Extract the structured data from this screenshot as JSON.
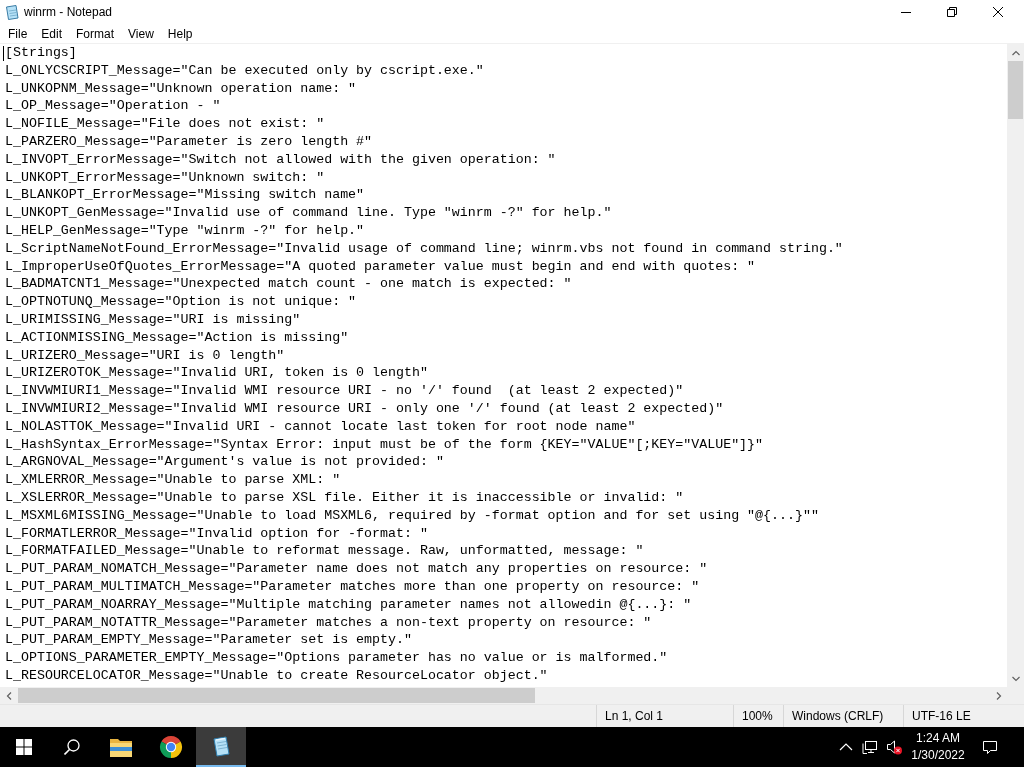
{
  "window": {
    "title": "winrm - Notepad"
  },
  "menu": [
    "File",
    "Edit",
    "Format",
    "View",
    "Help"
  ],
  "editor": {
    "lines": [
      "[Strings]",
      "L_ONLYCSCRIPT_Message=\"Can be executed only by cscript.exe.\"",
      "L_UNKOPNM_Message=\"Unknown operation name: \"",
      "L_OP_Message=\"Operation - \"",
      "L_NOFILE_Message=\"File does not exist: \"",
      "L_PARZERO_Message=\"Parameter is zero length #\"",
      "L_INVOPT_ErrorMessage=\"Switch not allowed with the given operation: \"",
      "L_UNKOPT_ErrorMessage=\"Unknown switch: \"",
      "L_BLANKOPT_ErrorMessage=\"Missing switch name\"",
      "L_UNKOPT_GenMessage=\"Invalid use of command line. Type \"winrm -?\" for help.\"",
      "L_HELP_GenMessage=\"Type \"winrm -?\" for help.\"",
      "L_ScriptNameNotFound_ErrorMessage=\"Invalid usage of command line; winrm.vbs not found in command string.\"",
      "L_ImproperUseOfQuotes_ErrorMessage=\"A quoted parameter value must begin and end with quotes: \"",
      "L_BADMATCNT1_Message=\"Unexpected match count - one match is expected: \"",
      "L_OPTNOTUNQ_Message=\"Option is not unique: \"",
      "L_URIMISSING_Message=\"URI is missing\"",
      "L_ACTIONMISSING_Message=\"Action is missing\"",
      "L_URIZERO_Message=\"URI is 0 length\"",
      "L_URIZEROTOK_Message=\"Invalid URI, token is 0 length\"",
      "L_INVWMIURI1_Message=\"Invalid WMI resource URI - no '/' found  (at least 2 expected)\"",
      "L_INVWMIURI2_Message=\"Invalid WMI resource URI - only one '/' found (at least 2 expected)\"",
      "L_NOLASTTOK_Message=\"Invalid URI - cannot locate last token for root node name\"",
      "L_HashSyntax_ErrorMessage=\"Syntax Error: input must be of the form {KEY=\"VALUE\"[;KEY=\"VALUE\"]}\"",
      "L_ARGNOVAL_Message=\"Argument's value is not provided: \"",
      "L_XMLERROR_Message=\"Unable to parse XML: \"",
      "L_XSLERROR_Message=\"Unable to parse XSL file. Either it is inaccessible or invalid: \"",
      "L_MSXML6MISSING_Message=\"Unable to load MSXML6, required by -format option and for set using \"@{...}\"\"",
      "L_FORMATLERROR_Message=\"Invalid option for -format: \"",
      "L_FORMATFAILED_Message=\"Unable to reformat message. Raw, unformatted, message: \"",
      "L_PUT_PARAM_NOMATCH_Message=\"Parameter name does not match any properties on resource: \"",
      "L_PUT_PARAM_MULTIMATCH_Message=\"Parameter matches more than one property on resource: \"",
      "L_PUT_PARAM_NOARRAY_Message=\"Multiple matching parameter names not allowedin @{...}: \"",
      "L_PUT_PARAM_NOTATTR_Message=\"Parameter matches a non-text property on resource: \"",
      "L_PUT_PARAM_EMPTY_Message=\"Parameter set is empty.\"",
      "L_OPTIONS_PARAMETER_EMPTY_Message=\"Options parameter has no value or is malformed.\"",
      "L_RESOURCELOCATOR_Message=\"Unable to create ResourceLocator object.\""
    ]
  },
  "status_bar": [
    "Ln 1, Col 1",
    "100%",
    "Windows (CRLF)",
    "UTF-16 LE"
  ],
  "taskbar": {
    "apps": [
      {
        "active": false
      },
      {
        "active": false
      },
      {
        "active": true
      }
    ],
    "tray": {
      "volume_muted": true,
      "time": "1:24 AM",
      "date": "1/30/2022"
    }
  }
}
